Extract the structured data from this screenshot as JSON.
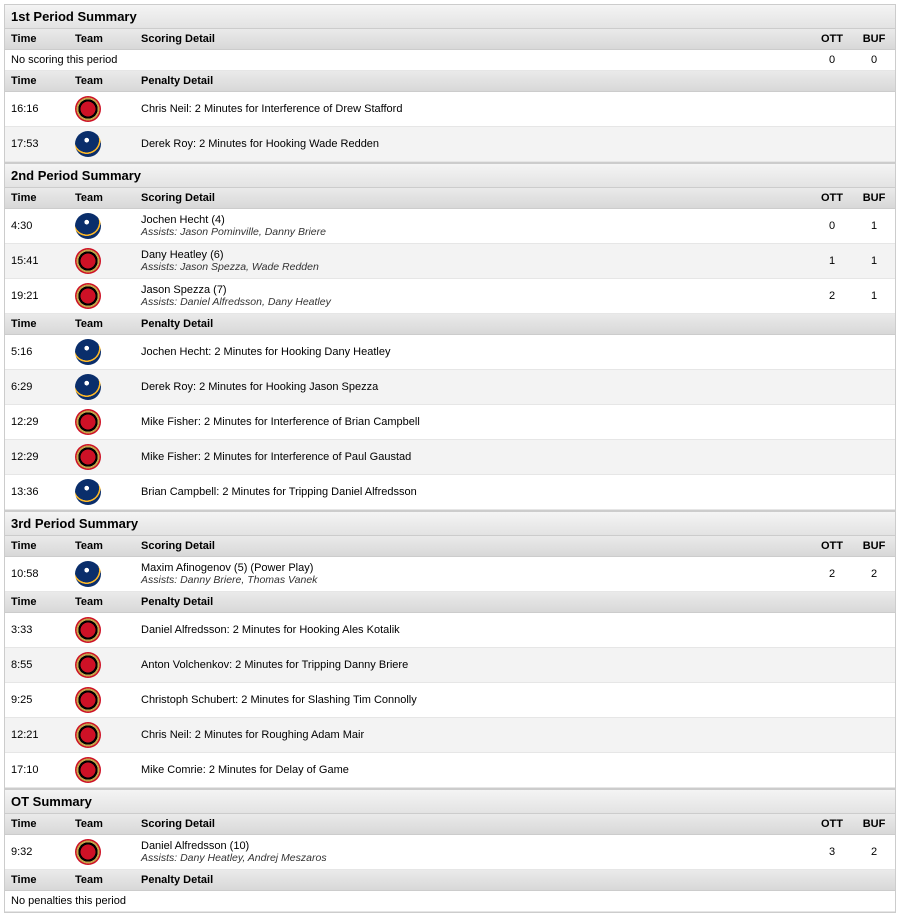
{
  "team_codes": {
    "away": "OTT",
    "home": "BUF"
  },
  "labels": {
    "time": "Time",
    "team": "Team",
    "scoring_detail": "Scoring Detail",
    "penalty_detail": "Penalty Detail",
    "no_scoring": "No scoring this period",
    "no_penalties": "No penalties this period"
  },
  "periods": [
    {
      "title": "1st Period Summary",
      "scoring": [],
      "no_score_running": {
        "ott": 0,
        "buf": 0
      },
      "penalties": [
        {
          "time": "16:16",
          "team": "OTT",
          "detail": "Chris Neil: 2 Minutes for Interference of Drew Stafford"
        },
        {
          "time": "17:53",
          "team": "BUF",
          "detail": "Derek Roy: 2 Minutes for Hooking Wade Redden"
        }
      ]
    },
    {
      "title": "2nd Period Summary",
      "scoring": [
        {
          "time": "4:30",
          "team": "BUF",
          "scorer": "Jochen Hecht (4)",
          "assists": "Assists: Jason Pominville, Danny Briere",
          "ott": 0,
          "buf": 1
        },
        {
          "time": "15:41",
          "team": "OTT",
          "scorer": "Dany Heatley (6)",
          "assists": "Assists: Jason Spezza, Wade Redden",
          "ott": 1,
          "buf": 1
        },
        {
          "time": "19:21",
          "team": "OTT",
          "scorer": "Jason Spezza (7)",
          "assists": "Assists: Daniel Alfredsson, Dany Heatley",
          "ott": 2,
          "buf": 1
        }
      ],
      "penalties": [
        {
          "time": "5:16",
          "team": "BUF",
          "detail": "Jochen Hecht: 2 Minutes for Hooking Dany Heatley"
        },
        {
          "time": "6:29",
          "team": "BUF",
          "detail": "Derek Roy: 2 Minutes for Hooking Jason Spezza"
        },
        {
          "time": "12:29",
          "team": "OTT",
          "detail": "Mike Fisher: 2 Minutes for Interference of Brian Campbell"
        },
        {
          "time": "12:29",
          "team": "OTT",
          "detail": "Mike Fisher: 2 Minutes for Interference of Paul Gaustad"
        },
        {
          "time": "13:36",
          "team": "BUF",
          "detail": "Brian Campbell: 2 Minutes for Tripping Daniel Alfredsson"
        }
      ]
    },
    {
      "title": "3rd Period Summary",
      "scoring": [
        {
          "time": "10:58",
          "team": "BUF",
          "scorer": "Maxim Afinogenov (5) (Power Play)",
          "assists": "Assists: Danny Briere, Thomas Vanek",
          "ott": 2,
          "buf": 2
        }
      ],
      "penalties": [
        {
          "time": "3:33",
          "team": "OTT",
          "detail": "Daniel Alfredsson: 2 Minutes for Hooking Ales Kotalik"
        },
        {
          "time": "8:55",
          "team": "OTT",
          "detail": "Anton Volchenkov: 2 Minutes for Tripping Danny Briere"
        },
        {
          "time": "9:25",
          "team": "OTT",
          "detail": "Christoph Schubert: 2 Minutes for Slashing Tim Connolly"
        },
        {
          "time": "12:21",
          "team": "OTT",
          "detail": "Chris Neil: 2 Minutes for Roughing Adam Mair"
        },
        {
          "time": "17:10",
          "team": "OTT",
          "detail": "Mike Comrie: 2 Minutes for Delay of Game"
        }
      ]
    },
    {
      "title": "OT Summary",
      "scoring": [
        {
          "time": "9:32",
          "team": "OTT",
          "scorer": "Daniel Alfredsson (10)",
          "assists": "Assists: Dany Heatley, Andrej Meszaros",
          "ott": 3,
          "buf": 2
        }
      ],
      "penalties": []
    }
  ]
}
